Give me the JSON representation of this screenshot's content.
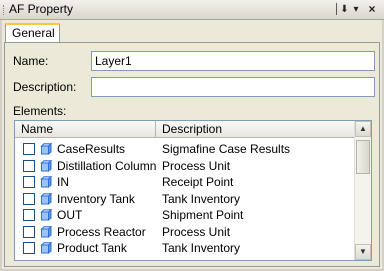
{
  "window": {
    "title": "AF Property",
    "pin_icon": "pin-icon",
    "menu_icon": "dropdown-arrow-icon",
    "close_icon": "close-icon"
  },
  "tabs": [
    {
      "label": "General",
      "selected": true
    }
  ],
  "form": {
    "name_label": "Name:",
    "name_value": "Layer1",
    "description_label": "Description:",
    "description_value": "",
    "elements_label": "Elements:"
  },
  "elements": {
    "columns": [
      "Name",
      "Description"
    ],
    "rows": [
      {
        "name": "CaseResults",
        "description": "Sigmafine Case Results",
        "checked": false
      },
      {
        "name": "Distillation Column",
        "description": "Process Unit",
        "checked": false
      },
      {
        "name": "IN",
        "description": "Receipt Point",
        "checked": false
      },
      {
        "name": "Inventory Tank",
        "description": "Tank Inventory",
        "checked": false
      },
      {
        "name": "OUT",
        "description": "Shipment Point",
        "checked": false
      },
      {
        "name": "Process Reactor",
        "description": "Process Unit",
        "checked": false
      },
      {
        "name": "Product Tank",
        "description": "Tank Inventory",
        "checked": false
      }
    ],
    "row_icon": "element-cube-icon"
  },
  "colors": {
    "tab_highlight": "#ffc83c",
    "checkbox_border": "#1c5180",
    "icon_blue": "#2f6fd6"
  }
}
